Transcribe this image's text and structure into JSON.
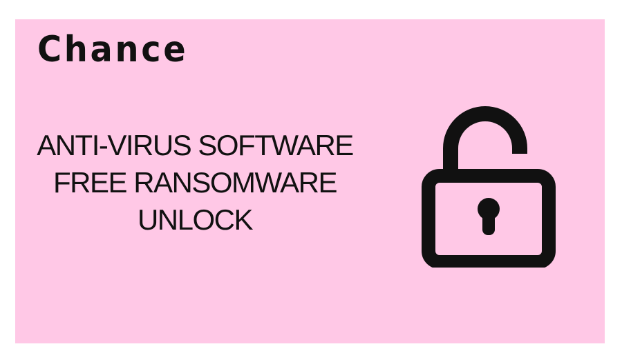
{
  "brand": {
    "name": "Chance"
  },
  "headline": {
    "lines": [
      "ANTI-VIRUS SOFTWARE",
      "FREE RANSOMWARE",
      "UNLOCK"
    ]
  },
  "icon": {
    "name": "unlocked-padlock-icon"
  },
  "colors": {
    "background": "#ffc8e6",
    "text": "#111111"
  }
}
